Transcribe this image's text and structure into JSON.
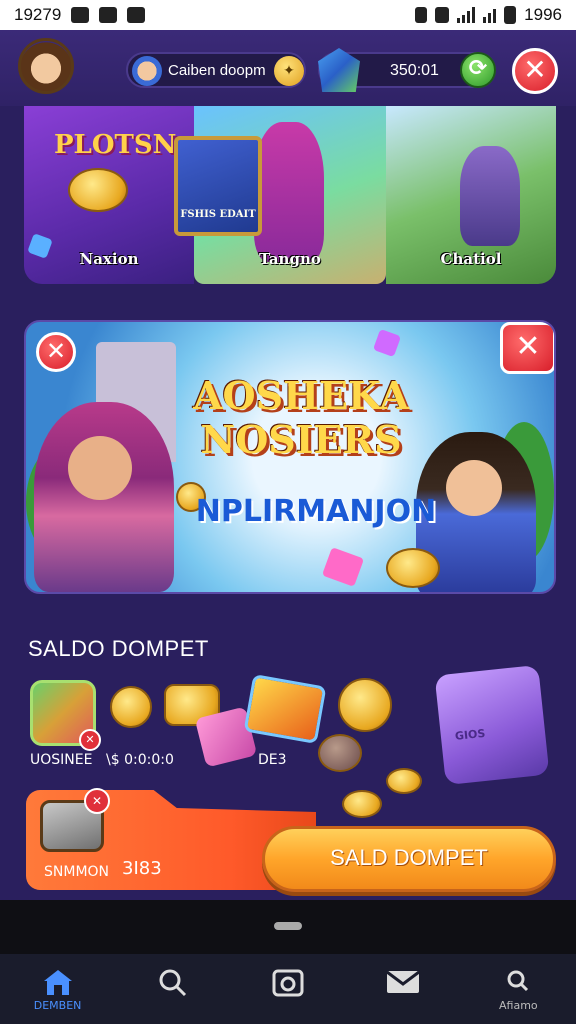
{
  "status_bar": {
    "time_left": "19279",
    "time_right": "1996"
  },
  "header": {
    "username": "Caiben doopm",
    "balance": "350:01",
    "coin_glyph": "✦",
    "add_glyph": "⟳",
    "close_glyph": "✕"
  },
  "featured_cards": [
    {
      "title": "PLOTSN",
      "label": "Naxion"
    },
    {
      "sign": "FSHIS EDAIT",
      "label": "Tangno"
    },
    {
      "label": "Chatiol"
    }
  ],
  "banner": {
    "title_line1": "AOSHEKA",
    "title_line2": "NOSIERS",
    "subtitle": "NPLIRMANJON",
    "close_glyph": "✕"
  },
  "wallet": {
    "title": "SALDO DOMPET",
    "item_label_1": "UOSINEE",
    "item_label_2": "\\$ 0:0:0:0",
    "item_label_3": "DE3",
    "scroll_text": "GIOS",
    "badge_glyph": "✕"
  },
  "reward": {
    "label": "SNMMON",
    "value": "3I83",
    "badge_glyph": "✕"
  },
  "cta": {
    "label": "SALD DOMPET"
  },
  "bottom_nav": {
    "items": [
      {
        "label": "DEMBEN",
        "icon": "home-icon",
        "active": true
      },
      {
        "label": "",
        "icon": "search-icon"
      },
      {
        "label": "",
        "icon": "camera-icon"
      },
      {
        "label": "",
        "icon": "mail-icon"
      },
      {
        "label": "Afiamo",
        "icon": "profile-icon"
      }
    ]
  },
  "colors": {
    "background": "#2a1f5e",
    "accent_orange": "#ffa52a",
    "close_red": "#d81e2a",
    "active_nav": "#4a90ff"
  }
}
